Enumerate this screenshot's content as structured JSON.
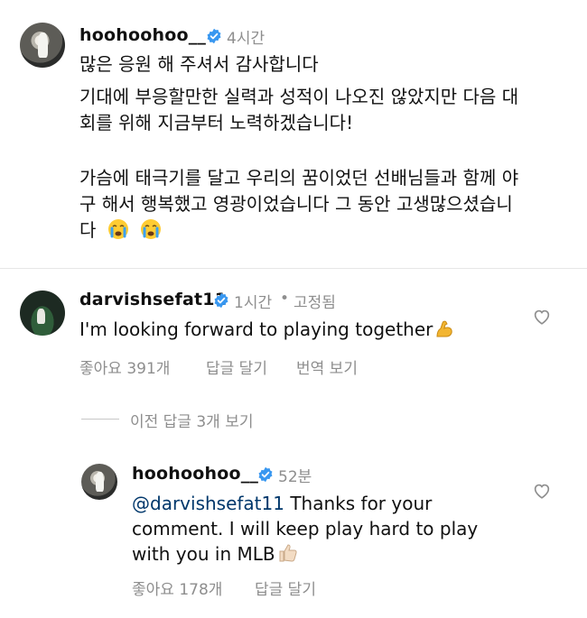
{
  "comments": [
    {
      "username": "hoohoohoo__",
      "time": "4시간",
      "lines": [
        "많은 응원 해 주셔서 감사합니다",
        "기대에 부응할만한 실력과 성적이 나오진 않았지만 다음 대",
        "회를 위해 지금부터 노력하겠습니다!",
        "가슴에 태극기를 달고 우리의 꿈이었던 선배님들과 함께 야",
        "구 해서 행복했고 영광이었습니다 그 동안 고생많으셨습니",
        "다"
      ],
      "emojis": [
        "crying-face",
        "crying-face"
      ]
    },
    {
      "username": "darvishsefat11",
      "time": "1시간",
      "separator": "•",
      "pinned": "고정됨",
      "text": "I'm looking forward to playing together",
      "emoji": "flexed-biceps",
      "likes": "좋아요 391개",
      "reply": "답글 달기",
      "translate": "번역 보기",
      "view_previous": "이전 답글 3개 보기"
    },
    {
      "username": "hoohoohoo__",
      "time": "52분",
      "mention": "@darvishsefat11",
      "lines": [
        " Thanks for your",
        "comment. I will keep play hard to play",
        "with you in MLB"
      ],
      "emoji": "thumbs-up",
      "likes": "좋아요 178개",
      "reply": "답글 달기"
    }
  ],
  "colors": {
    "text": "#111111",
    "secondary": "#8e8e8e",
    "verified": "#3897f0",
    "mention": "#00376b"
  }
}
